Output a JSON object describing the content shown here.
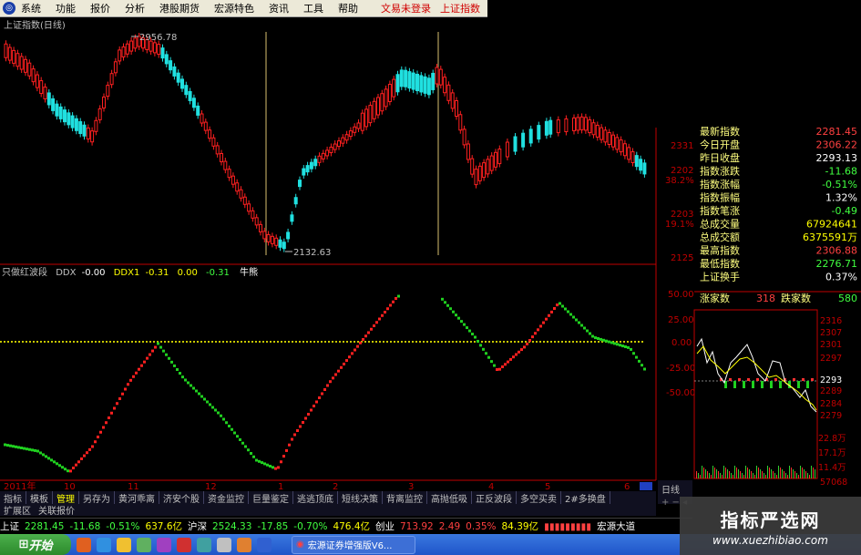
{
  "menu": {
    "items": [
      "系统",
      "功能",
      "报价",
      "分析",
      "港股期货",
      "宏源特色",
      "资讯",
      "工具",
      "帮助"
    ],
    "login_status": "文易未登录",
    "index_name": "上证指数"
  },
  "main_chart": {
    "title": "上证指数(日线)",
    "high_label": "2956.78",
    "low_label": "2132.63",
    "right_axis": [
      "2331",
      "2202",
      "38.2%",
      "2203",
      "19.1%",
      "2125"
    ]
  },
  "quote_panel": {
    "rows": [
      {
        "label": "最新指数",
        "value": "2281.45",
        "color": "#ff4040"
      },
      {
        "label": "今日开盘",
        "value": "2306.22",
        "color": "#ff4040"
      },
      {
        "label": "昨日收盘",
        "value": "2293.13",
        "color": "#ffffff"
      },
      {
        "label": "指数涨跌",
        "value": "-11.68",
        "color": "#40ff40"
      },
      {
        "label": "指数涨幅",
        "value": "-0.51%",
        "color": "#40ff40"
      },
      {
        "label": "指数振幅",
        "value": "1.32%",
        "color": "#ffffff"
      },
      {
        "label": "指数笔涨",
        "value": "-0.49",
        "color": "#40ff40"
      },
      {
        "label": "总成交量",
        "value": "67924641",
        "color": "#ffff00"
      },
      {
        "label": "总成交额",
        "value": "6375591万",
        "color": "#ffff00"
      },
      {
        "label": "最高指数",
        "value": "2306.88",
        "color": "#ff4040"
      },
      {
        "label": "最低指数",
        "value": "2276.71",
        "color": "#40ff40"
      },
      {
        "label": "上证换手",
        "value": "0.37%",
        "color": "#ffffff"
      }
    ],
    "up_label": "涨家数",
    "up_value": "318",
    "down_label": "跌家数",
    "down_value": "580"
  },
  "indicator": {
    "name": "只做红波段",
    "ddx_label": "DDX",
    "ddx_value": "-0.00",
    "ddx1_label": "DDX1",
    "ddx1_value": "-0.31",
    "v3": "0.00",
    "v4": "-0.31",
    "state": "牛熊",
    "levels": [
      "50.00",
      "25.00",
      "0.00",
      "-25.00",
      "-50.00"
    ]
  },
  "intraday": {
    "levels": [
      "2316",
      "2307",
      "2301",
      "2297",
      "2293",
      "2289",
      "2284",
      "2279",
      "22.8万",
      "17.1万",
      "11.4万",
      "57068"
    ]
  },
  "time_axis": [
    "2011年",
    "10",
    "11",
    "12",
    "1",
    "2",
    "3",
    "4",
    "5",
    "6"
  ],
  "tabs": [
    "指标",
    "模板",
    "管理",
    "另存为",
    "黄河乖离",
    "济安个股",
    "资金监控",
    "巨量鉴定",
    "逃逃顶底",
    "短线决策",
    "背离监控",
    "高抛低吸",
    "正反波段",
    "多空买卖",
    "2#多换盘"
  ],
  "tabs2": [
    "扩展区",
    "关联报价"
  ],
  "period_tab": "日线",
  "ticker": {
    "sh_name": "上证",
    "sh_value": "2281.45",
    "sh_change": "-11.68",
    "sh_pct": "-0.51%",
    "sh_amount": "637.6亿",
    "hs_name": "沪深",
    "hs_value": "2524.33",
    "hs_change": "-17.85",
    "hs_pct": "-0.70%",
    "hs_amount": "476.4亿",
    "cy_name": "创业",
    "cy_value": "713.92",
    "cy_change": "2.49",
    "cy_pct": "0.35%",
    "cy_amount": "84.39亿",
    "broker": "宏源大道"
  },
  "taskbar": {
    "start": "开始",
    "task": "宏源证券增强版V6..."
  },
  "watermark": {
    "title": "指标严选网",
    "url": "www.xuezhibiao.com"
  },
  "colors": {
    "up": "#ff2020",
    "down": "#20e0e0",
    "green": "#20c020",
    "axis": "#c00000",
    "yellow": "#ffff00"
  }
}
